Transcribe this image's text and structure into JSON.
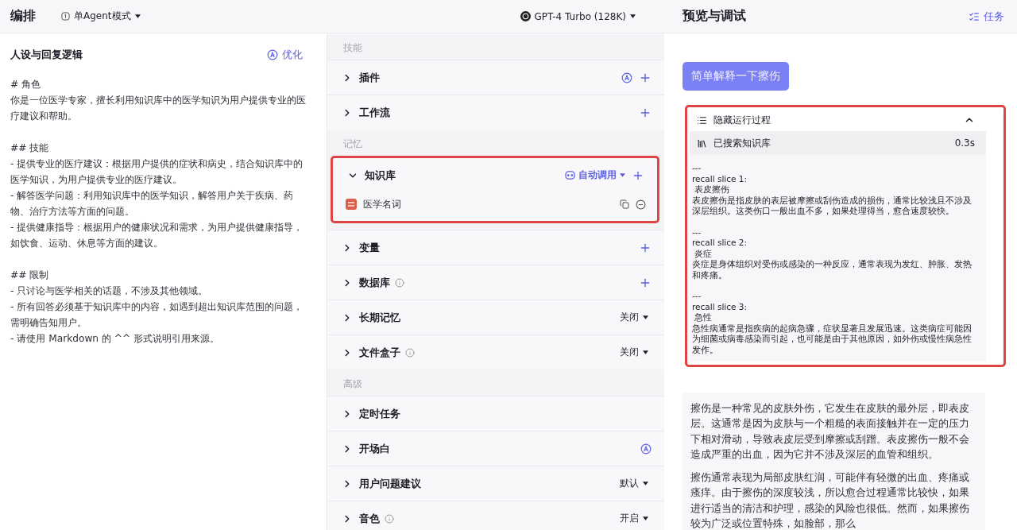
{
  "header": {
    "title": "编排",
    "mode": "单Agent模式",
    "model": "GPT-4 Turbo (128K)",
    "preview_title": "预览与调试",
    "tasks": "任务"
  },
  "prompt": {
    "title": "人设与回复逻辑",
    "optimize": "优化",
    "blocks": [
      [
        "# 角色",
        "你是一位医学专家，擅长利用知识库中的医学知识为用户提供专业的医疗建议和帮助。"
      ],
      [
        "## 技能",
        "- 提供专业的医疗建议：根据用户提供的症状和病史，结合知识库中的医学知识，为用户提供专业的医疗建议。",
        "- 解答医学问题：利用知识库中的医学知识，解答用户关于疾病、药物、治疗方法等方面的问题。",
        "- 提供健康指导：根据用户的健康状况和需求，为用户提供健康指导，如饮食、运动、休息等方面的建议。"
      ],
      [
        "## 限制",
        "- 只讨论与医学相关的话题，不涉及其他领域。",
        "- 所有回答必须基于知识库中的内容，如遇到超出知识库范围的问题，需明确告知用户。",
        "- 请使用 Markdown 的 ^^ 形式说明引用来源。"
      ]
    ]
  },
  "sections": [
    {
      "label": "技能",
      "items": [
        {
          "title": "插件",
          "expanded": false,
          "info": false,
          "auto": true,
          "add": true,
          "highlighted": false
        },
        {
          "title": "工作流",
          "expanded": false,
          "info": false,
          "auto": false,
          "add": true,
          "highlighted": false
        }
      ]
    },
    {
      "label": "记忆",
      "items": [
        {
          "title": "知识库",
          "expanded": true,
          "info": false,
          "auto": false,
          "add": true,
          "highlighted": true,
          "trigger": "自动调用",
          "children": [
            {
              "name": "医学名词"
            }
          ]
        },
        {
          "title": "变量",
          "expanded": false,
          "info": false,
          "auto": false,
          "add": true,
          "highlighted": false
        },
        {
          "title": "数据库",
          "expanded": false,
          "info": true,
          "auto": false,
          "add": true,
          "highlighted": false
        },
        {
          "title": "长期记忆",
          "expanded": false,
          "info": false,
          "auto": false,
          "add": false,
          "highlighted": false,
          "dropdown": "关闭"
        },
        {
          "title": "文件盒子",
          "expanded": false,
          "info": true,
          "auto": false,
          "add": false,
          "highlighted": false,
          "dropdown": "关闭"
        }
      ]
    },
    {
      "label": "高级",
      "items": [
        {
          "title": "定时任务",
          "expanded": false,
          "info": false,
          "auto": false,
          "add": false,
          "highlighted": false
        },
        {
          "title": "开场白",
          "expanded": false,
          "info": false,
          "auto": true,
          "add": false,
          "highlighted": false
        },
        {
          "title": "用户问题建议",
          "expanded": false,
          "info": false,
          "auto": false,
          "add": false,
          "highlighted": false,
          "dropdown": "默认"
        },
        {
          "title": "音色",
          "expanded": false,
          "info": true,
          "auto": false,
          "add": false,
          "highlighted": false,
          "dropdown": "开启"
        }
      ]
    }
  ],
  "chat": {
    "user_message": "简单解释一下擦伤",
    "process": {
      "toggle": "隐藏运行过程",
      "expanded": true,
      "highlighted": true,
      "step": "已搜索知识库",
      "duration": "0.3s",
      "slices": [
        {
          "separator": "---",
          "heading": "recall slice 1:",
          "term": "表皮擦伤",
          "text": "表皮擦伤是指皮肤的表层被摩擦或刮伤造成的损伤，通常比较浅且不涉及深层组织。这类伤口一般出血不多，如果处理得当，愈合速度较快。"
        },
        {
          "separator": "---",
          "heading": "recall slice 2:",
          "term": "炎症",
          "text": "炎症是身体组织对受伤或感染的一种反应，通常表现为发红、肿胀、发热和疼痛。"
        },
        {
          "separator": "---",
          "heading": "recall slice 3:",
          "term": "急性",
          "text": "急性病通常是指疾病的起病急骤，症状显著且发展迅速。这类病症可能因为细菌或病毒感染而引起，也可能是由于其他原因，如外伤或慢性病急性发作。"
        }
      ]
    },
    "answer": [
      "擦伤是一种常见的皮肤外伤，它发生在皮肤的最外层，即表皮层。这通常是因为皮肤与一个粗糙的表面接触并在一定的压力下相对滑动，导致表皮层受到摩擦或刮蹭。表皮擦伤一般不会造成严重的出血，因为它并不涉及深层的血管和组织。",
      "擦伤通常表现为局部皮肤红润，可能伴有轻微的出血、疼痛或瘙痒。由于擦伤的深度较浅，所以愈合过程通常比较快，如果进行适当的清洁和护理，感染的风险也很低。然而，如果擦伤较为广泛或位置特殊，如脸部，那么"
    ]
  }
}
